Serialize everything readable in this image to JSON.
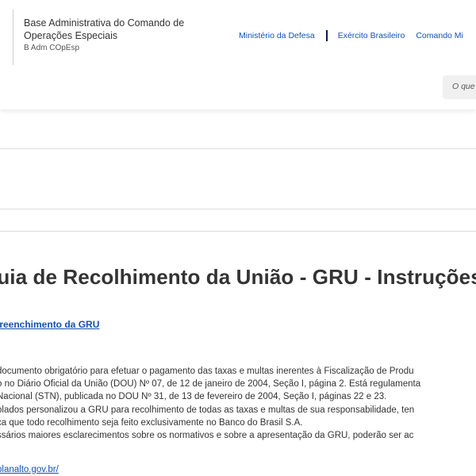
{
  "header": {
    "brand": {
      "name_line1": "Base Administrativa do Comando de",
      "name_line2": "Operações Especiais",
      "abbreviation": "B Adm COpEsp"
    },
    "top_links": [
      {
        "label": "Ministério da Defesa"
      },
      {
        "label": "Exército Brasileiro"
      },
      {
        "label": "Comando Mi"
      }
    ],
    "search": {
      "placeholder": "O que"
    }
  },
  "main": {
    "title": "Guia de Recolhimento da União - GRU - Instruções",
    "sublink": "preenchimento da GRU",
    "paragraph_lines": [
      "documento obrigatório para efetuar o pagamento das taxas e multas inerentes à Fiscalização de Produ",
      "o no Diário Oficial da União (DOU) Nº 07, de 12 de janeiro de 2004, Seção I, página 2. Está regulamenta",
      "Nacional (STN), publicada no DOU Nº 31, de 13 de fevereiro de 2004, Seção I, páginas 22 e 23.",
      "olados personalizou a GRU para recolhimento de todas as taxas e multas de sua responsabilidade, ten",
      "ca que todo recolhimento seja feito exclusivamente no Banco do Brasil S.A.",
      "ssários maiores esclarecimentos sobre os normativos e sobre a apresentação da GRU, poderão ser ac"
    ],
    "footer_link": "planalto.gov.br/"
  },
  "colors": {
    "link": "#1351b4",
    "divider_accent": "#071d41",
    "text": "#333333"
  }
}
